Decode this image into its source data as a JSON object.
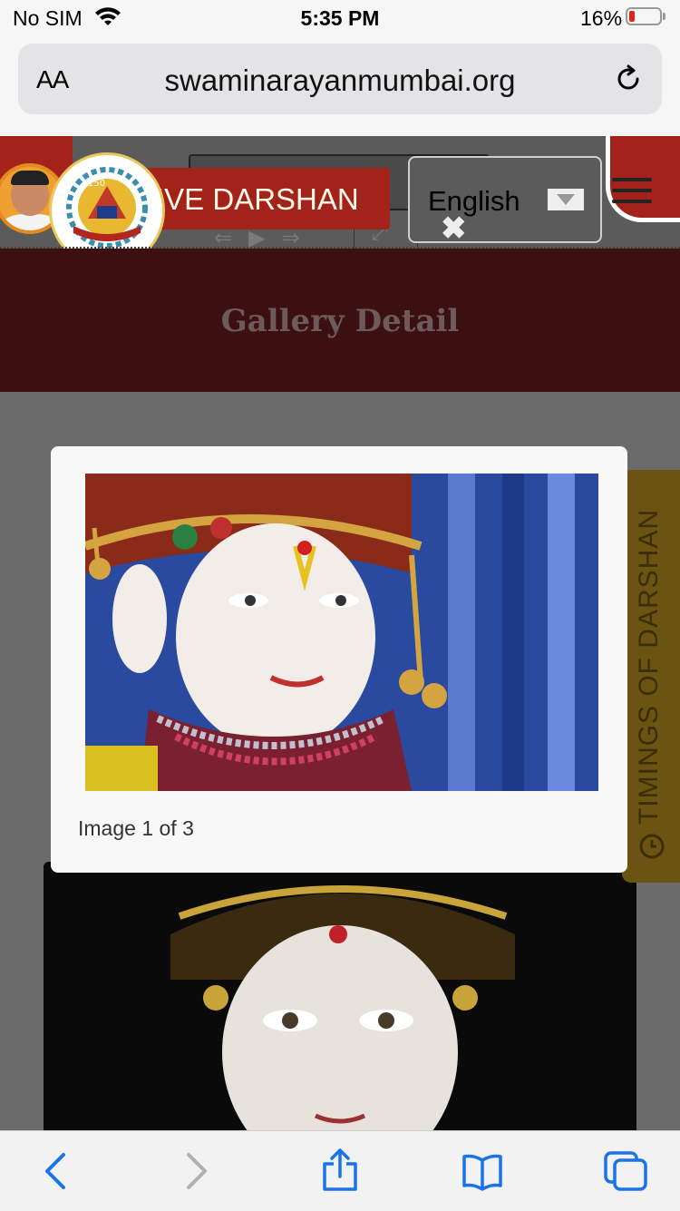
{
  "status_bar": {
    "carrier": "No SIM",
    "time": "5:35 PM",
    "battery_percent": "16%",
    "battery_level": 0.16,
    "battery_color": "#e0261c"
  },
  "browser": {
    "text_size_button": "AA",
    "url": "swaminarayanmumbai.org",
    "reload_icon": "reload-icon"
  },
  "header": {
    "live_darshan_label": "IVE DARSHAN",
    "language_select": {
      "selected": "English"
    },
    "menu_icon": "hamburger-icon",
    "brand_red": "#a3231a"
  },
  "page": {
    "title": "Gallery Detail"
  },
  "lightbox": {
    "caption": "Image 1 of 3",
    "current_index": 1,
    "total": 3
  },
  "side_tab": {
    "label": "TIMINGS OF DARSHAN",
    "icon": "clock-icon"
  },
  "toolbar": {
    "items": [
      "back-icon",
      "forward-icon",
      "share-icon",
      "bookmarks-icon",
      "tabs-icon"
    ],
    "accent": "#1a73e8"
  }
}
